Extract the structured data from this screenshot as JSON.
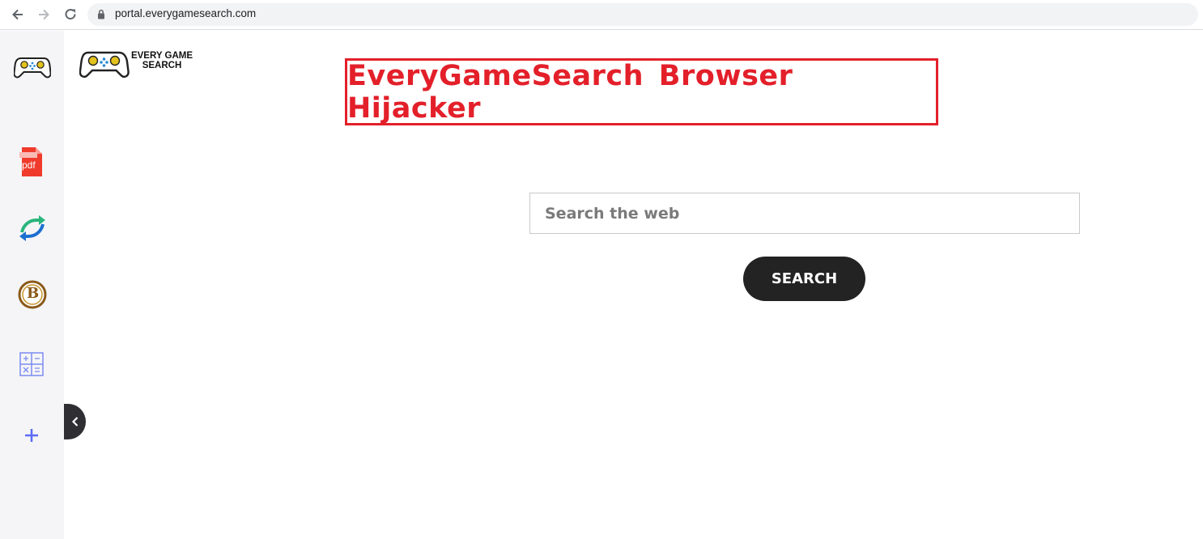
{
  "browser": {
    "url": "portal.everygamesearch.com"
  },
  "logo": {
    "text_line1": "EVERY GAME",
    "text_line2": "SEARCH"
  },
  "headline": "EveryGameSearch Browser Hijacker",
  "sidebar": {
    "items": [
      {
        "icon": "gamepad-icon"
      },
      {
        "icon": "pdf-icon",
        "label": "pdf"
      },
      {
        "icon": "converter-arrows-icon"
      },
      {
        "icon": "bitcoin-icon",
        "label": "B"
      },
      {
        "icon": "calculator-icon"
      },
      {
        "icon": "plus-icon"
      }
    ]
  },
  "search": {
    "placeholder": "Search the web",
    "button_label": "SEARCH"
  },
  "colors": {
    "headline_red": "#e3202a",
    "button_dark": "#232323",
    "sidebar_bg": "#f5f5f7",
    "accent_blue": "#5b6bf5"
  }
}
